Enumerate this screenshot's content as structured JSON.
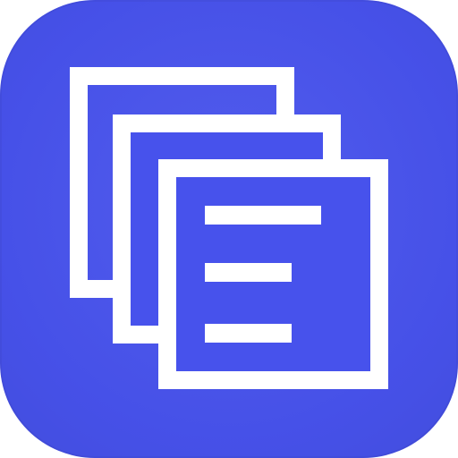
{
  "icon": {
    "name": "documents-stack-icon",
    "background_color": "#4752ec",
    "foreground_color": "#ffffff"
  }
}
